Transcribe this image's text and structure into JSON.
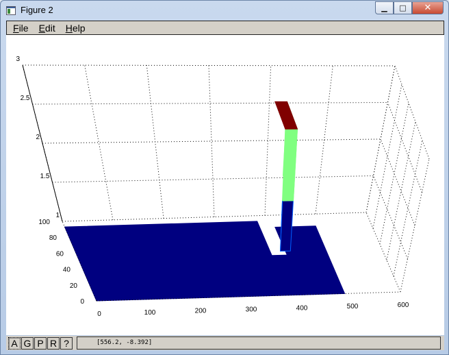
{
  "window": {
    "title": "Figure 2",
    "minimize_glyph": "▁",
    "maximize_glyph": "□",
    "close_glyph": "✕"
  },
  "menu": {
    "items": [
      {
        "label": "File",
        "mnemonic": "F",
        "rest": "ile"
      },
      {
        "label": "Edit",
        "mnemonic": "E",
        "rest": "dit"
      },
      {
        "label": "Help",
        "mnemonic": "H",
        "rest": "elp"
      }
    ]
  },
  "toolbar": {
    "buttons": [
      "A",
      "G",
      "P",
      "R",
      "?"
    ],
    "active": "A"
  },
  "status": {
    "coordinates": "[556.2, -8.392]"
  },
  "chart_data": {
    "type": "surface3d",
    "x_ticks": [
      "0",
      "100",
      "200",
      "300",
      "400",
      "500",
      "600"
    ],
    "y_ticks": [
      "0",
      "20",
      "40",
      "60",
      "80",
      "100"
    ],
    "z_ticks": [
      "1",
      "1.5",
      "2",
      "2.5",
      "3"
    ],
    "xlim": [
      0,
      600
    ],
    "ylim": [
      0,
      100
    ],
    "zlim": [
      1,
      3
    ],
    "grid": true,
    "colors": {
      "base": "#000080",
      "mid": "#80ff80",
      "top": "#800000",
      "edge": "#0060ff"
    }
  }
}
